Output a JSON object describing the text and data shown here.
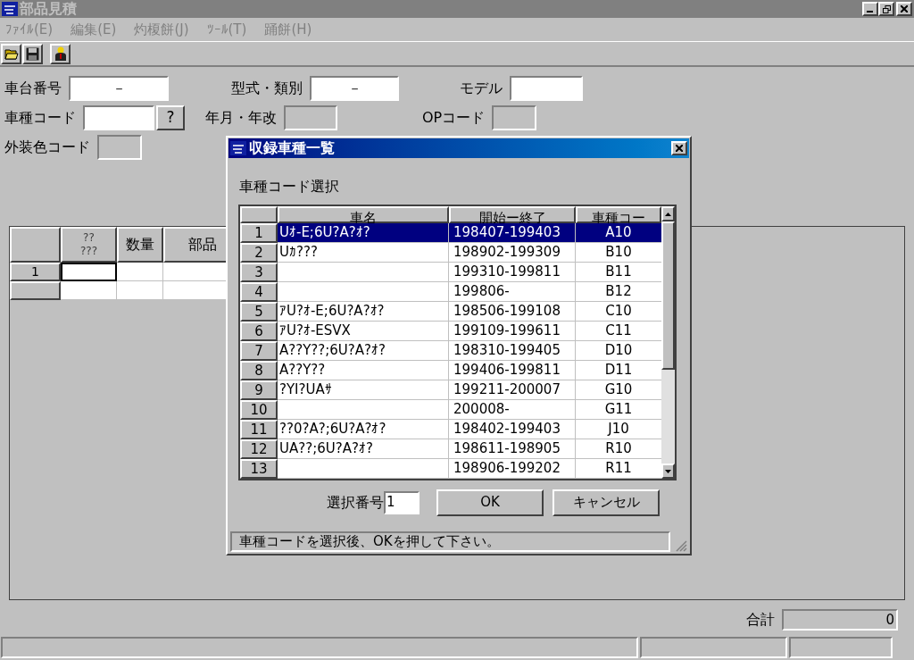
{
  "window": {
    "title": "部品見積",
    "active": false
  },
  "menu": [
    {
      "label": "ﾌｧｲﾙ(E)",
      "disabled": true
    },
    {
      "label": "編集(E)",
      "disabled": true
    },
    {
      "label": "灼榎餅(J)",
      "disabled": true
    },
    {
      "label": "ﾂｰﾙ(T)",
      "disabled": true
    },
    {
      "label": "踊餅(H)",
      "disabled": true
    }
  ],
  "form": [
    [
      {
        "label": "車台番号",
        "value": "－",
        "disabled": false
      },
      {
        "label": "型式・類別",
        "value": "－",
        "disabled": false
      },
      {
        "label": "モデル",
        "disabled": false
      }
    ],
    [
      {
        "label": "車種コード",
        "disabled": false,
        "button": "?"
      },
      {
        "label": "年月・年改",
        "disabled": true
      },
      {
        "label": "OPコード",
        "disabled": true
      }
    ],
    [
      {
        "label": "外装色コード",
        "disabled": true
      }
    ]
  ],
  "parts_grid": {
    "columns": [
      "??\n???",
      "数量",
      "部品"
    ],
    "rows": [
      {
        "number": "1",
        "focused": true
      },
      {
        "focused": false
      }
    ]
  },
  "total": {
    "label": "合計",
    "value": "0"
  },
  "dialog": {
    "title": "収録車種一覧",
    "subtitle": "車種コード選択",
    "columns": [
      "車名",
      "開始ー終了",
      "車種コー"
    ],
    "rows": [
      {
        "number": "1",
        "name": "Uｵ-E;6U?A?ｵ?",
        "period": "198407-199403",
        "code": "A10",
        "selected": true
      },
      {
        "number": "2",
        "name": "Uｶ???",
        "period": "198902-199309",
        "code": "B10",
        "selected": false
      },
      {
        "number": "3",
        "period": "199310-199811",
        "code": "B11",
        "selected": false
      },
      {
        "number": "4",
        "period": "199806-",
        "code": "B12",
        "selected": false
      },
      {
        "number": "5",
        "name": "ｱU?ｵ-E;6U?A?ｵ?",
        "period": "198506-199108",
        "code": "C10",
        "selected": false
      },
      {
        "number": "6",
        "name": "ｱU?ｵ-ESVX",
        "period": "199109-199611",
        "code": "C11",
        "selected": false
      },
      {
        "number": "7",
        "name": "A??Y??;6U?A?ｵ?",
        "period": "198310-199405",
        "code": "D10",
        "selected": false
      },
      {
        "number": "8",
        "name": "A??Y??",
        "period": "199406-199811",
        "code": "D11",
        "selected": false
      },
      {
        "number": "9",
        "name": "?YI?UAｻ",
        "period": "199211-200007",
        "code": "G10",
        "selected": false
      },
      {
        "number": "10",
        "period": "200008-",
        "code": "G11",
        "selected": false
      },
      {
        "number": "11",
        "name": "??0?A?;6U?A?ｵ?",
        "period": "198402-199403",
        "code": "J10",
        "selected": false
      },
      {
        "number": "12",
        "name": "UA??;6U?A?ｵ?",
        "period": "198611-198905",
        "code": "R10",
        "selected": false
      },
      {
        "number": "13",
        "period": "198906-199202",
        "code": "R11",
        "selected": false
      }
    ],
    "selection": {
      "label": "選択番号",
      "value": "1"
    },
    "buttons": [
      "OK",
      "キャンセル"
    ],
    "status": "車種コードを選択後、OKを押して下さい。"
  }
}
